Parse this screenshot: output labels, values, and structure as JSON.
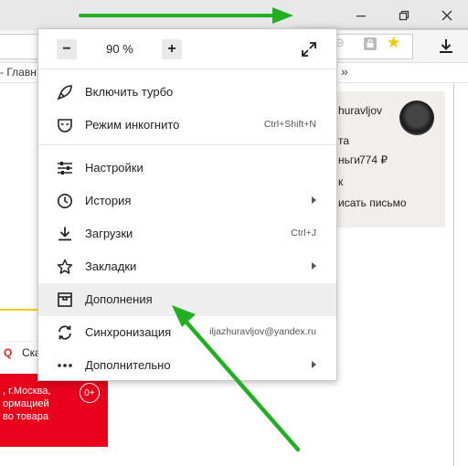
{
  "window": {
    "menu_icon": "hamburger-icon",
    "minimize_icon": "minimize-icon",
    "maximize_icon": "restore-icon",
    "close_icon": "close-icon"
  },
  "bookmarks_bar": {
    "text": "- Главн",
    "more": "»"
  },
  "account": {
    "lines": [
      "huravljov",
      "та",
      "ньги",
      "774 ₽",
      "к",
      "исать письмо"
    ]
  },
  "page": {
    "search_snippet": "Ска",
    "banner_lines": [
      ", г.Москва,",
      "ормацией",
      "во товара"
    ],
    "banner_badge": "0+"
  },
  "menu": {
    "zoom": {
      "minus": "−",
      "value": "90 %",
      "plus": "+"
    },
    "items": [
      {
        "label": "Включить турбо",
        "shortcut": "",
        "icon": "rocket-icon",
        "submenu": false
      },
      {
        "label": "Режим инкогнито",
        "shortcut": "Ctrl+Shift+N",
        "icon": "incognito-mask-icon",
        "submenu": false
      },
      {
        "label": "Настройки",
        "shortcut": "",
        "icon": "settings-sliders-icon",
        "submenu": false
      },
      {
        "label": "История",
        "shortcut": "",
        "icon": "history-clock-icon",
        "submenu": true
      },
      {
        "label": "Загрузки",
        "shortcut": "Ctrl+J",
        "icon": "download-icon",
        "submenu": false
      },
      {
        "label": "Закладки",
        "shortcut": "",
        "icon": "bookmark-star-icon",
        "submenu": true
      },
      {
        "label": "Дополнения",
        "shortcut": "",
        "icon": "extensions-icon",
        "submenu": false,
        "highlighted": true
      },
      {
        "label": "Синхронизация",
        "shortcut": "iljazhuravljov@yandex.ru",
        "icon": "sync-icon",
        "submenu": false
      },
      {
        "label": "Дополнительно",
        "shortcut": "",
        "icon": "more-dots-icon",
        "submenu": true
      }
    ]
  },
  "colors": {
    "annotation_arrow": "#22b022",
    "banner_red": "#e8001c",
    "star_yellow": "#f5c400"
  }
}
